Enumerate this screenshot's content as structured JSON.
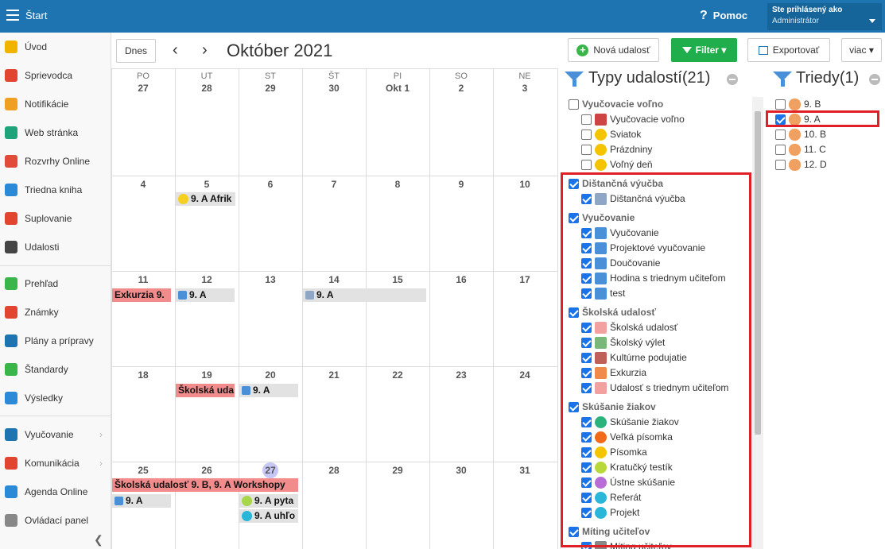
{
  "topbar": {
    "title": "Štart",
    "help": "Pomoc",
    "user_line1": "Ste prihlásený ako",
    "user_line2": "Administrátor"
  },
  "sidebar": {
    "items": [
      {
        "label": "Úvod",
        "icon": "star-icon",
        "color": "#f0b400"
      },
      {
        "label": "Sprievodca",
        "icon": "wand-icon",
        "color": "#e2452f"
      },
      {
        "label": "Notifikácie",
        "icon": "envelope-icon",
        "color": "#f0a020"
      },
      {
        "label": "Web stránka",
        "icon": "house-icon",
        "color": "#1fa37a"
      },
      {
        "label": "Rozvrhy Online",
        "icon": "grid-icon",
        "color": "#e24a3a"
      },
      {
        "label": "Triedna kniha",
        "icon": "book-icon",
        "color": "#2a8ad8"
      },
      {
        "label": "Suplovanie",
        "icon": "person-icon",
        "color": "#e2452f"
      },
      {
        "label": "Udalosti",
        "icon": "calendar-icon",
        "color": "#444444"
      },
      {
        "label": "Prehľad",
        "icon": "check-circle-icon",
        "color": "#3ab54a"
      },
      {
        "label": "Známky",
        "icon": "grade-icon",
        "color": "#e2452f"
      },
      {
        "label": "Plány a prípravy",
        "icon": "briefcase-icon",
        "color": "#1d74b0"
      },
      {
        "label": "Štandardy",
        "icon": "shield-icon",
        "color": "#3ab54a"
      },
      {
        "label": "Výsledky",
        "icon": "bar-chart-icon",
        "color": "#2a8ad8"
      },
      {
        "label": "Vyučovanie",
        "icon": "open-book-icon",
        "color": "#1d74b0"
      },
      {
        "label": "Komunikácia",
        "icon": "chat-icon",
        "color": "#e2452f"
      },
      {
        "label": "Agenda Online",
        "icon": "pen-icon",
        "color": "#2a8ad8"
      },
      {
        "label": "Ovládací panel",
        "icon": "gear-icon",
        "color": "#888888"
      }
    ]
  },
  "toolbar": {
    "today": "Dnes",
    "month": "Október 2021",
    "new_event": "Nová udalosť",
    "filter": "Filter ▾",
    "export": "Exportovať",
    "more": "viac ▾"
  },
  "calendar": {
    "weekdays": [
      "PO",
      "UT",
      "ST",
      "ŠT",
      "PI",
      "SO",
      "NE"
    ],
    "week1": [
      "27",
      "28",
      "29",
      "30",
      "Okt 1",
      "2",
      "3"
    ],
    "week2": [
      "4",
      "5",
      "6",
      "7",
      "8",
      "9",
      "10"
    ],
    "week3": [
      "11",
      "12",
      "13",
      "14",
      "15",
      "16",
      "17"
    ],
    "week4": [
      "18",
      "19",
      "20",
      "21",
      "22",
      "23",
      "24"
    ],
    "week5": [
      "25",
      "26",
      "27",
      "28",
      "29",
      "30",
      "31"
    ],
    "events": {
      "e1": "9. A Afrik",
      "e2": "Exkurzia 9.",
      "e3": "9. A",
      "e4": "9. A",
      "e5": "Školská uda",
      "e6": "9. A",
      "e7": "Školská udalosť 9. B, 9. A Workshopy",
      "e8": "9. A",
      "e9": "9. A pyta",
      "e10": "9. A uhľo"
    }
  },
  "types_panel": {
    "title": "Typy udalostí(21)",
    "groups": [
      {
        "label": "Vyučovacie voľno",
        "checked": false,
        "items": [
          "Vyučovacie voľno",
          "Sviatok",
          "Prázdniny",
          "Voľný deň"
        ]
      },
      {
        "label": "Dištančná výučba",
        "checked": true,
        "items": [
          "Dištančná výučba"
        ]
      },
      {
        "label": "Vyučovanie",
        "checked": true,
        "items": [
          "Vyučovanie",
          "Projektové vyučovanie",
          "Doučovanie",
          "Hodina s triednym učiteľom",
          "test"
        ]
      },
      {
        "label": "Školská udalosť",
        "checked": true,
        "items": [
          "Školská udalosť",
          "Školský výlet",
          "Kultúrne podujatie",
          "Exkurzia",
          "Udalosť s triednym učiteľom"
        ]
      },
      {
        "label": "Skúšanie žiakov",
        "checked": true,
        "items": [
          "Skúšanie žiakov",
          "Veľká písomka",
          "Písomka",
          "Kratučký testík",
          "Ústne skúšanie",
          "Referát",
          "Projekt"
        ]
      },
      {
        "label": "Míting učiteľov",
        "checked": true,
        "items": [
          "Míting učiteľov"
        ]
      }
    ]
  },
  "classes_panel": {
    "title": "Triedy(1)",
    "items": [
      {
        "label": "9. B",
        "checked": false
      },
      {
        "label": "9. A",
        "checked": true
      },
      {
        "label": "10. B",
        "checked": false
      },
      {
        "label": "11. C",
        "checked": false
      },
      {
        "label": "12. D",
        "checked": false
      }
    ]
  }
}
